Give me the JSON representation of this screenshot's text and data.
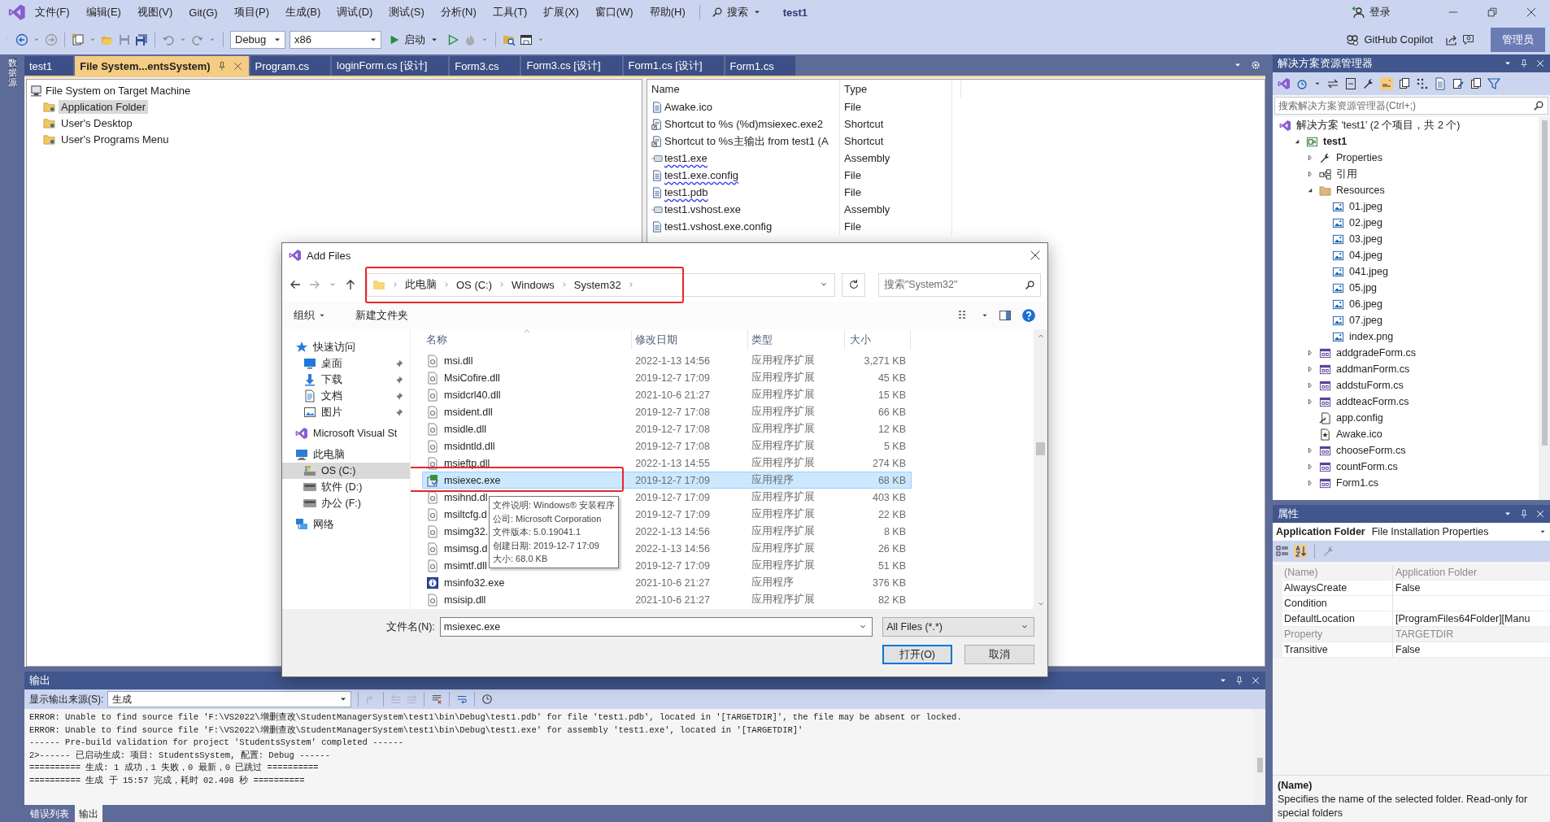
{
  "menu": {
    "items": [
      "文件(F)",
      "编辑(E)",
      "视图(V)",
      "Git(G)",
      "项目(P)",
      "生成(B)",
      "调试(D)",
      "测试(S)",
      "分析(N)",
      "工具(T)",
      "扩展(X)",
      "窗口(W)",
      "帮助(H)"
    ],
    "search": "搜索",
    "solution_title": "test1",
    "sign_in": "登录"
  },
  "toolbar": {
    "configuration": "Debug",
    "platform": "x86",
    "start": "启动",
    "copilot": "GitHub Copilot",
    "account": "管理员"
  },
  "side_strip": {
    "label": "数据源"
  },
  "doc_tabs": [
    {
      "label": "test1",
      "selected": false
    },
    {
      "label": "File System...entsSystem)",
      "selected": true
    },
    {
      "label": "Program.cs",
      "selected": false
    },
    {
      "label": "loginForm.cs [设计]",
      "selected": false
    },
    {
      "label": "Form3.cs",
      "selected": false
    },
    {
      "label": "Form3.cs [设计]",
      "selected": false
    },
    {
      "label": "Form1.cs [设计]",
      "selected": false
    },
    {
      "label": "Form1.cs",
      "selected": false
    }
  ],
  "file_system": {
    "tree": {
      "label": "File System on Target Machine",
      "children": [
        {
          "label": "Application Folder",
          "selected": true
        },
        {
          "label": "User's Desktop",
          "selected": false
        },
        {
          "label": "User's Programs Menu",
          "selected": false
        }
      ]
    },
    "columns": [
      "Name",
      "Type"
    ],
    "rows": [
      {
        "name": "Awake.ico",
        "type": "File",
        "kind": "file",
        "flagged": false
      },
      {
        "name": "Shortcut to %s (%d)msiexec.exe2",
        "type": "Shortcut",
        "kind": "shortcut",
        "flagged": false
      },
      {
        "name": "Shortcut to %s主输出 from test1 (A",
        "type": "Shortcut",
        "kind": "shortcut",
        "flagged": false
      },
      {
        "name": "test1.exe",
        "type": "Assembly",
        "kind": "assembly",
        "flagged": true
      },
      {
        "name": "test1.exe.config",
        "type": "File",
        "kind": "file",
        "flagged": true
      },
      {
        "name": "test1.pdb",
        "type": "File",
        "kind": "file",
        "flagged": true
      },
      {
        "name": "test1.vshost.exe",
        "type": "Assembly",
        "kind": "assembly",
        "flagged": false
      },
      {
        "name": "test1.vshost.exe.config",
        "type": "File",
        "kind": "file",
        "flagged": false
      }
    ]
  },
  "dialog": {
    "title": "Add Files",
    "path": [
      "此电脑",
      "OS (C:)",
      "Windows",
      "System32"
    ],
    "path_highlighted": true,
    "search": {
      "placeholder": "搜索\"System32\""
    },
    "commands": [
      "组织",
      "新建文件夹"
    ],
    "nav": [
      {
        "label": "快速访问",
        "kind": "star",
        "selected": false,
        "children": [
          {
            "label": "桌面",
            "kind": "desktop",
            "pinned": true,
            "selected": false
          },
          {
            "label": "下载",
            "kind": "download",
            "pinned": true,
            "selected": false
          },
          {
            "label": "文档",
            "kind": "document",
            "pinned": true,
            "selected": false
          },
          {
            "label": "图片",
            "kind": "pictures",
            "pinned": true,
            "selected": false
          }
        ]
      },
      {
        "label": "Microsoft Visual St",
        "kind": "vs",
        "selected": false
      },
      {
        "label": "此电脑",
        "kind": "pc",
        "selected": false,
        "children": [
          {
            "label": "OS (C:)",
            "kind": "osdrive",
            "pinned": false,
            "selected": true
          },
          {
            "label": "软件 (D:)",
            "kind": "drive",
            "pinned": false,
            "selected": false
          },
          {
            "label": "办公 (F:)",
            "kind": "drive",
            "pinned": false,
            "selected": false
          }
        ]
      },
      {
        "label": "网络",
        "kind": "network",
        "selected": false
      }
    ],
    "columns": [
      "名称",
      "修改日期",
      "类型",
      "大小"
    ],
    "rows": [
      {
        "name": "msi.dll",
        "date": "2022-1-13 14:56",
        "type": "应用程序扩展",
        "size": "3,271 KB",
        "kind": "dll",
        "selected": false,
        "highlighted": false
      },
      {
        "name": "MsiCofire.dll",
        "date": "2019-12-7 17:09",
        "type": "应用程序扩展",
        "size": "45 KB",
        "kind": "dll",
        "selected": false,
        "highlighted": false
      },
      {
        "name": "msidcrl40.dll",
        "date": "2021-10-6 21:27",
        "type": "应用程序扩展",
        "size": "15 KB",
        "kind": "dll",
        "selected": false,
        "highlighted": false
      },
      {
        "name": "msident.dll",
        "date": "2019-12-7 17:08",
        "type": "应用程序扩展",
        "size": "66 KB",
        "kind": "dll",
        "selected": false,
        "highlighted": false
      },
      {
        "name": "msidle.dll",
        "date": "2019-12-7 17:08",
        "type": "应用程序扩展",
        "size": "12 KB",
        "kind": "dll",
        "selected": false,
        "highlighted": false
      },
      {
        "name": "msidntld.dll",
        "date": "2019-12-7 17:08",
        "type": "应用程序扩展",
        "size": "5 KB",
        "kind": "dll",
        "selected": false,
        "highlighted": false
      },
      {
        "name": "msieftp.dll",
        "date": "2022-1-13 14:55",
        "type": "应用程序扩展",
        "size": "274 KB",
        "kind": "dll",
        "selected": false,
        "highlighted": false
      },
      {
        "name": "msiexec.exe",
        "date": "2019-12-7 17:09",
        "type": "应用程序",
        "size": "68 KB",
        "kind": "installer",
        "selected": true,
        "highlighted": true
      },
      {
        "name": "msihnd.dl",
        "date": "2019-12-7 17:09",
        "type": "应用程序扩展",
        "size": "403 KB",
        "kind": "dll",
        "selected": false,
        "highlighted": false
      },
      {
        "name": "msiltcfg.d",
        "date": "2019-12-7 17:09",
        "type": "应用程序扩展",
        "size": "22 KB",
        "kind": "dll",
        "selected": false,
        "highlighted": false
      },
      {
        "name": "msimg32.",
        "date": "2022-1-13 14:56",
        "type": "应用程序扩展",
        "size": "8 KB",
        "kind": "dll",
        "selected": false,
        "highlighted": false
      },
      {
        "name": "msimsg.d",
        "date": "2022-1-13 14:56",
        "type": "应用程序扩展",
        "size": "26 KB",
        "kind": "dll",
        "selected": false,
        "highlighted": false
      },
      {
        "name": "msimtf.dll",
        "date": "2019-12-7 17:09",
        "type": "应用程序扩展",
        "size": "51 KB",
        "kind": "dll",
        "selected": false,
        "highlighted": false
      },
      {
        "name": "msinfo32.exe",
        "date": "2021-10-6 21:27",
        "type": "应用程序",
        "size": "376 KB",
        "kind": "info",
        "selected": false,
        "highlighted": false
      },
      {
        "name": "msisip.dll",
        "date": "2021-10-6 21:27",
        "type": "应用程序扩展",
        "size": "82 KB",
        "kind": "dll",
        "selected": false,
        "highlighted": false
      }
    ],
    "tooltip": [
      "文件说明: Windows® 安装程序",
      "公司: Microsoft Corporation",
      "文件版本: 5.0.19041.1",
      "创建日期: 2019-12-7 17:09",
      "大小: 68.0 KB"
    ],
    "file_name_label": "文件名(N):",
    "file_name": "msiexec.exe",
    "filter": "All Files (*.*)",
    "buttons": [
      {
        "label": "打开(O)",
        "default": true
      },
      {
        "label": "取消",
        "default": false
      }
    ]
  },
  "output": {
    "title": "输出",
    "source_label": "显示输出来源(S):",
    "source": "生成",
    "lines": [
      "ERROR: Unable to find source file 'F:\\VS2022\\增删查改\\StudentManagerSystem\\test1\\bin\\Debug\\test1.pdb' for file 'test1.pdb', located in '[TARGETDIR]', the file may be absent or locked.",
      "ERROR: Unable to find source file 'F:\\VS2022\\增删查改\\StudentManagerSystem\\test1\\bin\\Debug\\test1.exe' for assembly 'test1.exe', located in '[TARGETDIR]'",
      "------ Pre-build validation for project 'StudentsSystem' completed ------",
      "2>------ 已启动生成: 项目: StudentsSystem, 配置: Debug ------",
      "========== 生成: 1 成功，1 失败，0 最新，0 已跳过 ==========",
      "========== 生成 于 15:57 完成，耗时 02.498 秒 =========="
    ]
  },
  "bottom_tabs": [
    {
      "label": "错误列表",
      "selected": false
    },
    {
      "label": "输出",
      "selected": true
    }
  ],
  "solution_explorer": {
    "title": "解决方案资源管理器",
    "search": {
      "placeholder": "搜索解决方案资源管理器(Ctrl+;)"
    },
    "solution": "解决方案 'test1' (2 个项目，共 2 个)",
    "tree": [
      {
        "label": "test1",
        "kind": "project",
        "expanded": true,
        "children": [
          {
            "label": "Properties",
            "kind": "wrench",
            "expanded": false
          },
          {
            "label": "引用",
            "kind": "refs",
            "expanded": false
          },
          {
            "label": "Resources",
            "kind": "folder",
            "expanded": true,
            "children": [
              {
                "label": "01.jpeg",
                "kind": "image"
              },
              {
                "label": "02.jpeg",
                "kind": "image"
              },
              {
                "label": "03.jpeg",
                "kind": "image"
              },
              {
                "label": "04.jpeg",
                "kind": "image"
              },
              {
                "label": "041.jpeg",
                "kind": "image"
              },
              {
                "label": "05.jpg",
                "kind": "image"
              },
              {
                "label": "06.jpeg",
                "kind": "image"
              },
              {
                "label": "07.jpeg",
                "kind": "image"
              },
              {
                "label": "index.png",
                "kind": "image"
              }
            ]
          },
          {
            "label": "addgradeForm.cs",
            "kind": "form",
            "expanded": false
          },
          {
            "label": "addmanForm.cs",
            "kind": "form",
            "expanded": false
          },
          {
            "label": "addstuForm.cs",
            "kind": "form",
            "expanded": false
          },
          {
            "label": "addteacForm.cs",
            "kind": "form",
            "expanded": false
          },
          {
            "label": "app.config",
            "kind": "config"
          },
          {
            "label": "Awake.ico",
            "kind": "ico"
          },
          {
            "label": "chooseForm.cs",
            "kind": "form",
            "expanded": false
          },
          {
            "label": "countForm.cs",
            "kind": "form",
            "expanded": false
          },
          {
            "label": "Form1.cs",
            "kind": "form",
            "expanded": false
          }
        ]
      }
    ]
  },
  "properties": {
    "title": "属性",
    "object": "Application Folder",
    "object_type": "File Installation Properties",
    "sort_alphabetical": true,
    "rows": [
      {
        "name": "(Name)",
        "value": "Application Folder",
        "readonly": true
      },
      {
        "name": "AlwaysCreate",
        "value": "False",
        "readonly": false
      },
      {
        "name": "Condition",
        "readonly": false
      },
      {
        "name": "DefaultLocation",
        "value": "[ProgramFiles64Folder][Manu",
        "readonly": false
      },
      {
        "name": "Property",
        "value": "TARGETDIR",
        "readonly": true
      },
      {
        "name": "Transitive",
        "value": "False",
        "readonly": false
      }
    ],
    "description_title": "(Name)",
    "description": "Specifies the name of the selected folder. Read-only for special folders"
  }
}
